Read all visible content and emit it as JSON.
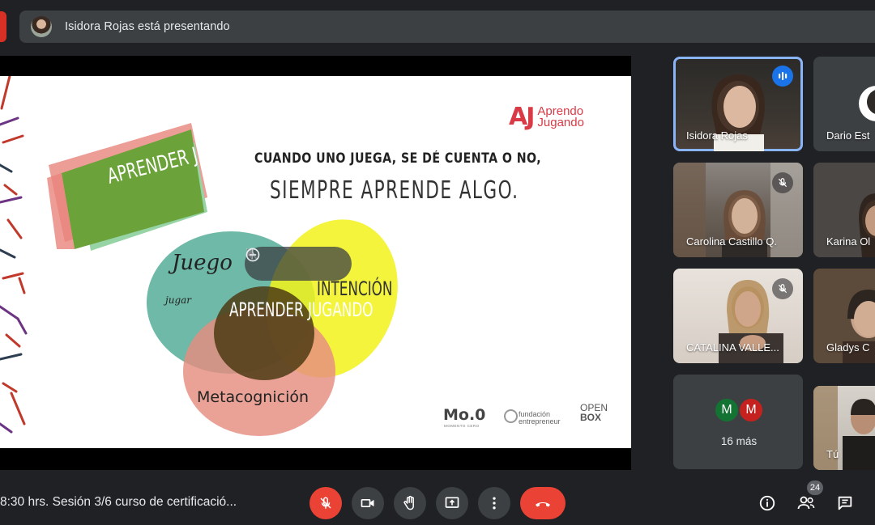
{
  "presentation_banner": {
    "text": "Isidora Rojas está presentando"
  },
  "slide": {
    "banner_text": "APRENDER JUGANDO",
    "quote_line1": "CUANDO UNO JUEGA, SE DÉ CUENTA O NO,",
    "quote_line2": "SIEMPRE APRENDE ALGO.",
    "logo_mark": "AJ",
    "logo_line1": "Aprendo",
    "logo_line2": "Jugando",
    "venn_juego": "Juego",
    "venn_jugar": "jugar",
    "venn_intencion": "INTENCIÓN",
    "venn_center": "APRENDER JUGANDO",
    "venn_metacognicion": "Metacognición",
    "sponsor_moo": "Mo.0",
    "sponsor_moo_sub": "MOMENTO CERO",
    "sponsor_fundacion_1": "fundación",
    "sponsor_fundacion_2": "entrepreneur",
    "sponsor_open": "OPEN",
    "sponsor_box": "BOX"
  },
  "participants": [
    {
      "name": "Isidora Rojas",
      "state": "speaking"
    },
    {
      "name": "Dario Est",
      "state": "none"
    },
    {
      "name": "Carolina Castillo Q.",
      "state": "muted"
    },
    {
      "name": "Karina Ol",
      "state": "none"
    },
    {
      "name": "CATALINA VALLE...",
      "state": "muted"
    },
    {
      "name": "Gladys C",
      "state": "none"
    },
    {
      "name": "Tú",
      "state": "none"
    }
  ],
  "more_tile": {
    "avatars": [
      {
        "initial": "M",
        "color": "#137333"
      },
      {
        "initial": "M",
        "color": "#c5221f"
      }
    ],
    "label": "16 más"
  },
  "bottom_bar": {
    "meeting_title": "8:30 hrs. Sesión 3/6 curso de certificació...",
    "participant_count": "24"
  },
  "colors": {
    "background": "#202124",
    "surface": "#3c4043",
    "danger": "#ea4335",
    "speaking_outline": "#8ab4f8"
  }
}
